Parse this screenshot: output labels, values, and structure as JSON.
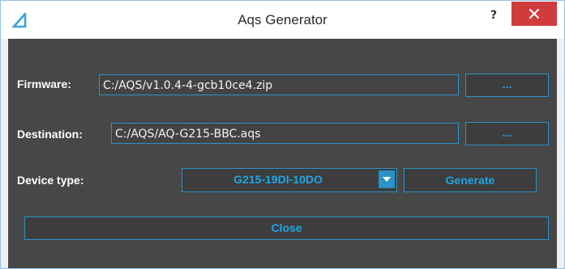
{
  "window": {
    "title": "Aqs Generator",
    "help_label": "?",
    "accent_color": "#2b93c5",
    "close_color": "#d03c3c",
    "icons": {
      "app": "aqs-logo-icon",
      "close": "close-icon",
      "dropdown": "chevron-down-icon"
    }
  },
  "firmware": {
    "label": "Firmware:",
    "value": "C:/AQS/v1.0.4-4-gcb10ce4.zip",
    "browse_label": "..."
  },
  "destination": {
    "label": "Destination:",
    "value": "C:/AQS/AQ-G215-BBC.aqs",
    "browse_label": "..."
  },
  "device": {
    "label": "Device type:",
    "selected": "G215-19DI-10DO",
    "generate_label": "Generate"
  },
  "footer": {
    "close_label": "Close"
  }
}
